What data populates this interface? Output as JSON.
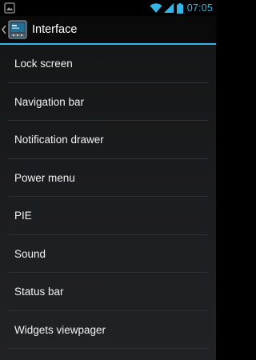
{
  "status_bar": {
    "time": "07:05",
    "clock_color": "#33b5e5",
    "icons": [
      "notification-icon",
      "wifi-icon",
      "signal-icon",
      "battery-icon"
    ]
  },
  "action_bar": {
    "title": "Interface",
    "accent_color": "#33b5e5"
  },
  "menu": {
    "items": [
      {
        "label": "Lock screen"
      },
      {
        "label": "Navigation bar"
      },
      {
        "label": "Notification drawer"
      },
      {
        "label": "Power menu"
      },
      {
        "label": "PIE"
      },
      {
        "label": "Sound"
      },
      {
        "label": "Status bar"
      },
      {
        "label": "Widgets viewpager"
      }
    ]
  }
}
